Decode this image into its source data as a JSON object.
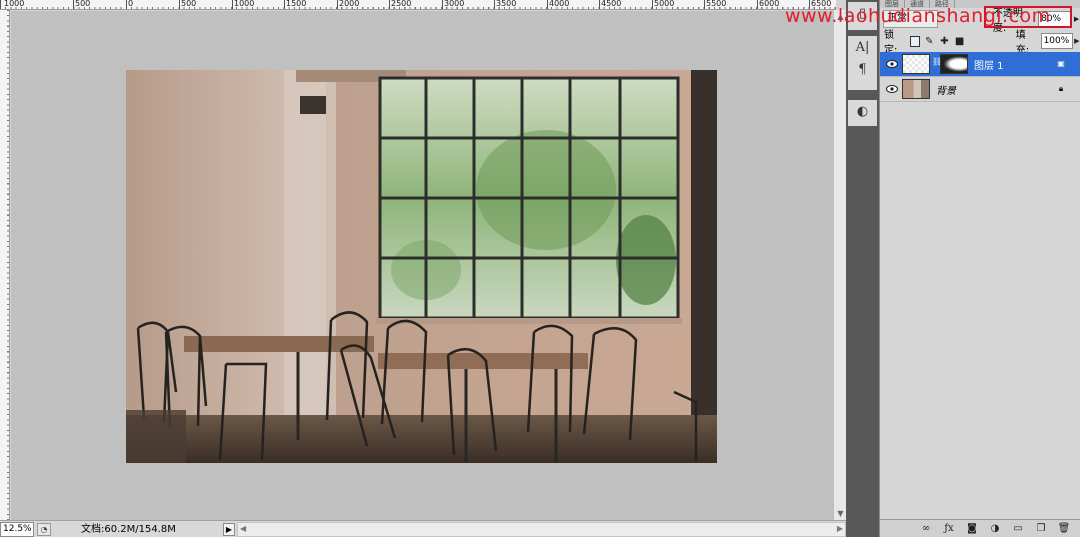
{
  "ruler": {
    "top_labels": [
      "1000",
      "500",
      "0",
      "500",
      "1000",
      "1500",
      "2000",
      "2500",
      "3000",
      "3500",
      "4000",
      "4500",
      "5000",
      "5500",
      "6000",
      "6500"
    ]
  },
  "status": {
    "zoom": "12.5%",
    "doc_info": "文档:60.2M/154.8M"
  },
  "layers_panel": {
    "tabs": [
      "图层",
      "通道",
      "路径"
    ],
    "blend_mode": "正常",
    "opacity_label": "不透明度:",
    "opacity_value": "80%",
    "lock_label": "锁定:",
    "fill_label": "填充:",
    "fill_value": "100%",
    "layers": [
      {
        "name": "图层 1",
        "selected": true
      },
      {
        "name": "背景",
        "selected": false
      }
    ]
  },
  "watermark": {
    "text": "www.laohudianshangi.com"
  },
  "colors": {
    "selection": "#2f6ed6",
    "highlight": "#d0142c",
    "watermark": "#e11d2e"
  }
}
